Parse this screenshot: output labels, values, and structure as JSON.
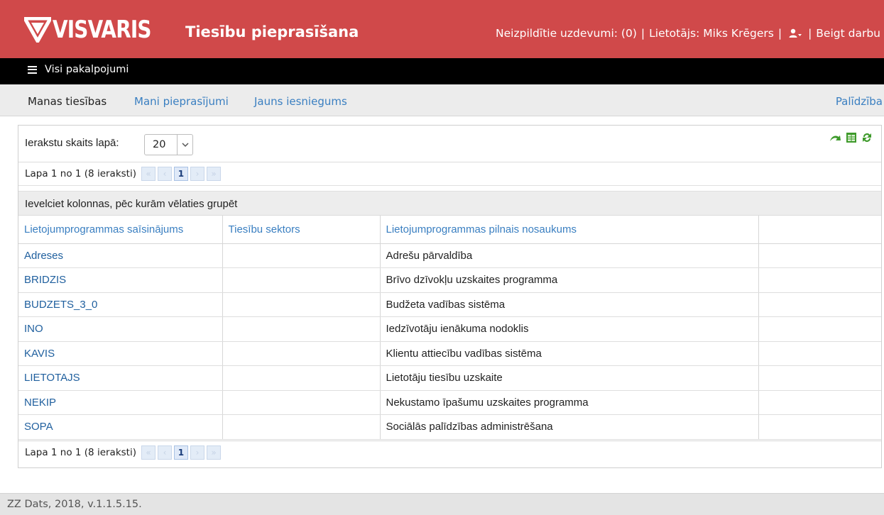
{
  "header": {
    "logo_text": "VISVARIS",
    "app_title": "Tiesību pieprasīšana",
    "pending_tasks": "Neizpildītie uzdevumi: (0)",
    "separator": "|",
    "user_label": "Lietotājs: Miks Krēgers",
    "logout": "Beigt darbu",
    "brand_color": "#d0494a"
  },
  "navbar": {
    "all_services": "Visi pakalpojumi"
  },
  "subnav": {
    "tabs": [
      {
        "label": "Manas tiesības",
        "active": true
      },
      {
        "label": "Mani pieprasījumi",
        "active": false
      },
      {
        "label": "Jauns iesniegums",
        "active": false
      }
    ],
    "help": "Palīdzība"
  },
  "grid": {
    "rows_per_page_label": "Ierakstu skaits lapā:",
    "rows_per_page_value": "20",
    "pager_text": "Lapa 1 no 1 (8 ieraksti)",
    "current_page": "1",
    "group_hint": "Ievelciet kolonnas, pēc kurām vēlaties grupēt",
    "toolbar_icons": [
      "undo-icon",
      "excel-export-icon",
      "refresh-icon"
    ],
    "columns": [
      "Lietojumprogrammas saīsinājums",
      "Tiesību sektors",
      "Lietojumprogrammas pilnais nosaukums",
      ""
    ],
    "rows": [
      {
        "code": "Adreses",
        "sector": "",
        "name": "Adrešu pārvaldība"
      },
      {
        "code": "BRIDZIS",
        "sector": "",
        "name": "Brīvo dzīvokļu uzskaites programma"
      },
      {
        "code": "BUDZETS_3_0",
        "sector": "",
        "name": "Budžeta vadības sistēma"
      },
      {
        "code": "INO",
        "sector": "",
        "name": "Iedzīvotāju ienākuma nodoklis"
      },
      {
        "code": "KAVIS",
        "sector": "",
        "name": "Klientu attiecību vadības sistēma"
      },
      {
        "code": "LIETOTAJS",
        "sector": "",
        "name": "Lietotāju tiesību uzskaite"
      },
      {
        "code": "NEKIP",
        "sector": "",
        "name": "Nekustamo īpašumu uzskaites programma"
      },
      {
        "code": "SOPA",
        "sector": "",
        "name": "Sociālās palīdzības administrēšana"
      }
    ]
  },
  "footer": {
    "text": "ZZ Dats, 2018, v.1.1.5.15."
  }
}
